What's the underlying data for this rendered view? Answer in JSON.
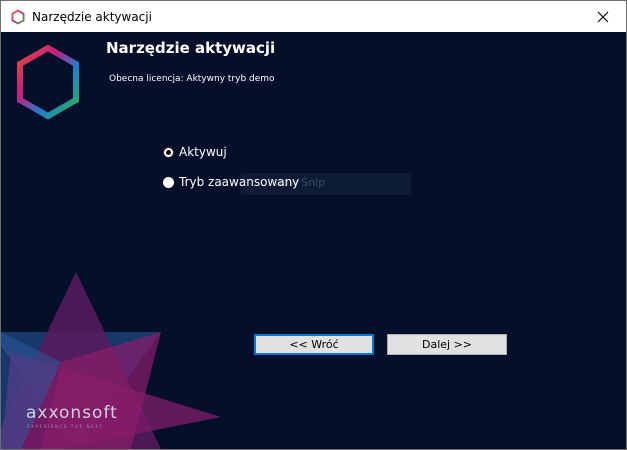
{
  "window": {
    "title": "Narzędzie aktywacji",
    "close_glyph": "✕"
  },
  "header": {
    "title": "Narzędzie aktywacji",
    "license_text": "Obecna licencja: Aktywny tryb demo",
    "logo_icon": "hexagon-logo-icon"
  },
  "options": [
    {
      "label": "Aktywuj",
      "selected": true
    },
    {
      "label": "Tryb zaawansowany",
      "selected": false
    }
  ],
  "ghost_text": "dow Snip",
  "buttons": {
    "back_label": "<< Wróć",
    "next_label": "Dalej >>"
  },
  "brand": {
    "name": "axxonsoft",
    "tagline": "EXPERIENCE THE NEXT"
  },
  "colors": {
    "background": "#040f2a",
    "accent_blue": "#0078d7",
    "deco_magenta": "#8b1d6b",
    "deco_blue": "#1b4f8a"
  }
}
